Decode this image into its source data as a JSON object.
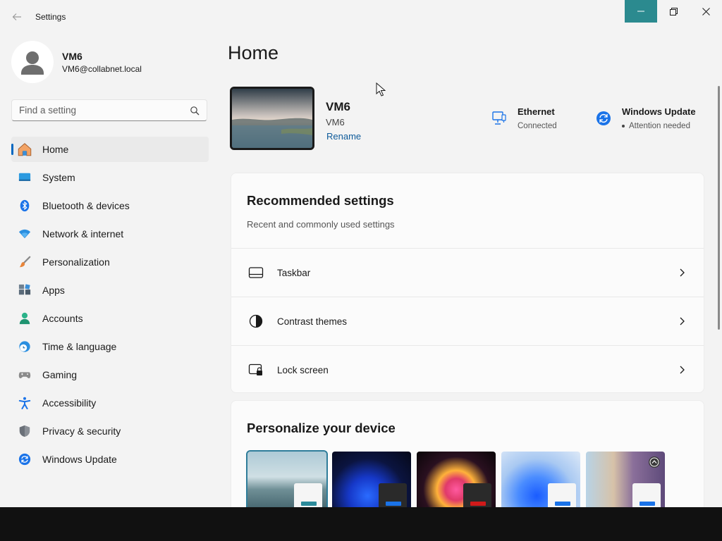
{
  "window": {
    "title": "Settings"
  },
  "profile": {
    "name": "VM6",
    "email": "VM6@collabnet.local"
  },
  "search": {
    "placeholder": "Find a setting",
    "value": ""
  },
  "nav": {
    "items": [
      {
        "label": "Home",
        "icon": "home-icon",
        "active": true
      },
      {
        "label": "System",
        "icon": "system-icon"
      },
      {
        "label": "Bluetooth & devices",
        "icon": "bluetooth-icon"
      },
      {
        "label": "Network & internet",
        "icon": "wifi-icon"
      },
      {
        "label": "Personalization",
        "icon": "brush-icon"
      },
      {
        "label": "Apps",
        "icon": "apps-icon"
      },
      {
        "label": "Accounts",
        "icon": "accounts-icon"
      },
      {
        "label": "Time & language",
        "icon": "globe-clock-icon"
      },
      {
        "label": "Gaming",
        "icon": "gamepad-icon"
      },
      {
        "label": "Accessibility",
        "icon": "accessibility-icon"
      },
      {
        "label": "Privacy & security",
        "icon": "shield-icon"
      },
      {
        "label": "Windows Update",
        "icon": "update-icon"
      }
    ]
  },
  "main": {
    "title": "Home",
    "device": {
      "name": "VM6",
      "model": "VM6",
      "rename": "Rename"
    },
    "status": {
      "network": {
        "title": "Ethernet",
        "subtitle": "Connected"
      },
      "update": {
        "title": "Windows Update",
        "subtitle": "Attention needed"
      }
    },
    "recommended": {
      "title": "Recommended settings",
      "subtitle": "Recent and commonly used settings",
      "items": [
        {
          "label": "Taskbar",
          "icon": "taskbar-icon"
        },
        {
          "label": "Contrast themes",
          "icon": "contrast-icon"
        },
        {
          "label": "Lock screen",
          "icon": "lock-screen-icon"
        }
      ]
    },
    "personalize": {
      "title": "Personalize your device"
    }
  },
  "colors": {
    "accent": "#0067c0",
    "minimize_hover": "#2b8a8f",
    "link": "#0f5b9a"
  }
}
